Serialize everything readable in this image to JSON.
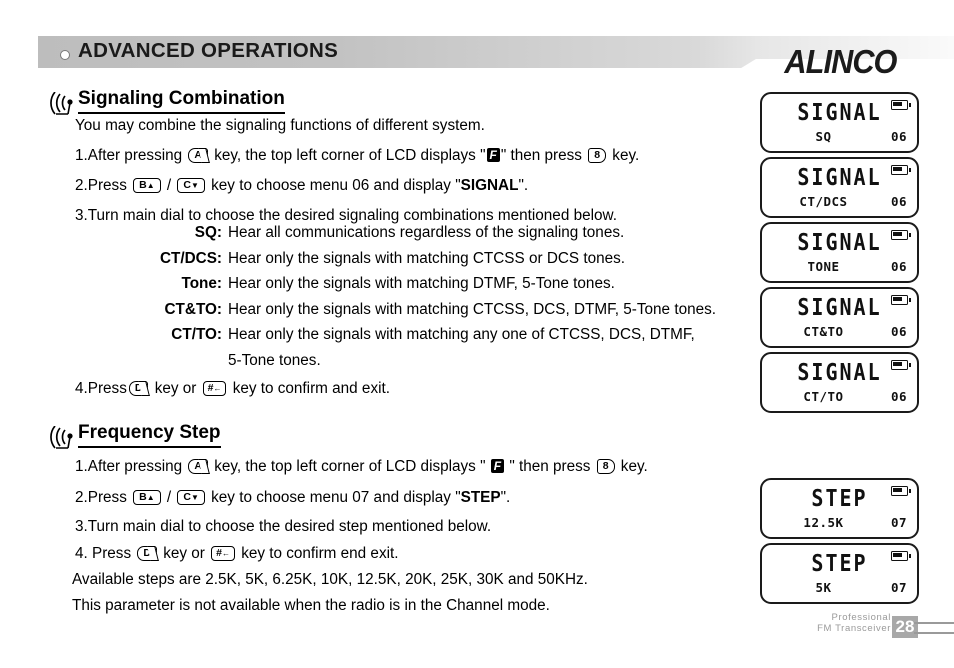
{
  "header": {
    "title": "ADVANCED OPERATIONS",
    "bullet_icon": "circle-bullet-icon",
    "brand": "ALINCO"
  },
  "sections": [
    {
      "id": "signaling-combination",
      "heading": "Signaling Combination",
      "intro": "You may combine the signaling functions of different system.",
      "steps": {
        "s1_a": "1.After pressing",
        "s1_b": "key, the top left corner of LCD displays \"",
        "s1_f": "F",
        "s1_c": "\" then press",
        "s1_d": "key.",
        "s2_a": "2.Press",
        "s2_slash": "/",
        "s2_b": "key to choose menu 06 and display \"",
        "s2_bold": "SIGNAL",
        "s2_c": "\".",
        "s3": "3.Turn main dial to choose the desired signaling combinations mentioned below.",
        "s4_a": "4.Press",
        "s4_b": "key or",
        "s4_c": "key to confirm and exit."
      },
      "keys": {
        "a": "A",
        "b_num": "8",
        "b_up": "B",
        "c_down": "C",
        "d": "D",
        "hash": "#"
      },
      "definitions": [
        {
          "term": "SQ:",
          "desc": "Hear all communications regardless of the signaling tones."
        },
        {
          "term": "CT/DCS:",
          "desc": "Hear only the signals with matching CTCSS or DCS tones."
        },
        {
          "term": "Tone:",
          "desc": "Hear only the signals with matching DTMF, 5-Tone tones."
        },
        {
          "term": "CT&TO:",
          "desc": "Hear only the signals with matching CTCSS, DCS, DTMF, 5-Tone tones."
        },
        {
          "term": "CT/TO:",
          "desc": "Hear only the signals with matching any one of CTCSS, DCS, DTMF,",
          "desc2": "5-Tone tones."
        }
      ]
    },
    {
      "id": "frequency-step",
      "heading": "Frequency Step",
      "steps": {
        "s1_a": "1.After pressing",
        "s1_b": "key, the top left corner of LCD displays \"",
        "s1_f": "F",
        "s1_c": "\" then press",
        "s1_d": "key.",
        "s2_a": "2.Press",
        "s2_slash": "/",
        "s2_b": "key to choose menu 07 and display \"",
        "s2_bold": "STEP",
        "s2_c": "\".",
        "s3": "3.Turn main dial to choose the desired step mentioned below.",
        "s4_a": "4. Press",
        "s4_b": "key or",
        "s4_c": "key to confirm end exit.",
        "s5": "Available steps are 2.5K, 5K, 6.25K, 10K, 12.5K, 20K, 25K, 30K and 50KHz.",
        "s6": "This parameter is not available when the radio is in the Channel mode."
      },
      "keys": {
        "a": "A",
        "b_num": "8",
        "b_up": "B",
        "c_down": "C",
        "d": "D",
        "hash": "#"
      }
    }
  ],
  "lcd_panels": [
    {
      "main": "SIGNAL",
      "sub": "SQ",
      "num": "06"
    },
    {
      "main": "SIGNAL",
      "sub": "CT/DCS",
      "num": "06"
    },
    {
      "main": "SIGNAL",
      "sub": "TONE",
      "num": "06"
    },
    {
      "main": "SIGNAL",
      "sub": "CT&TO",
      "num": "06"
    },
    {
      "main": "SIGNAL",
      "sub": "CT/TO",
      "num": "06"
    },
    {
      "main": "STEP",
      "sub": "12.5K",
      "num": "07"
    },
    {
      "main": "STEP",
      "sub": "5K",
      "num": "07"
    }
  ],
  "footer": {
    "line1": "Professional",
    "line2": "FM Transceiver",
    "page": "28"
  }
}
